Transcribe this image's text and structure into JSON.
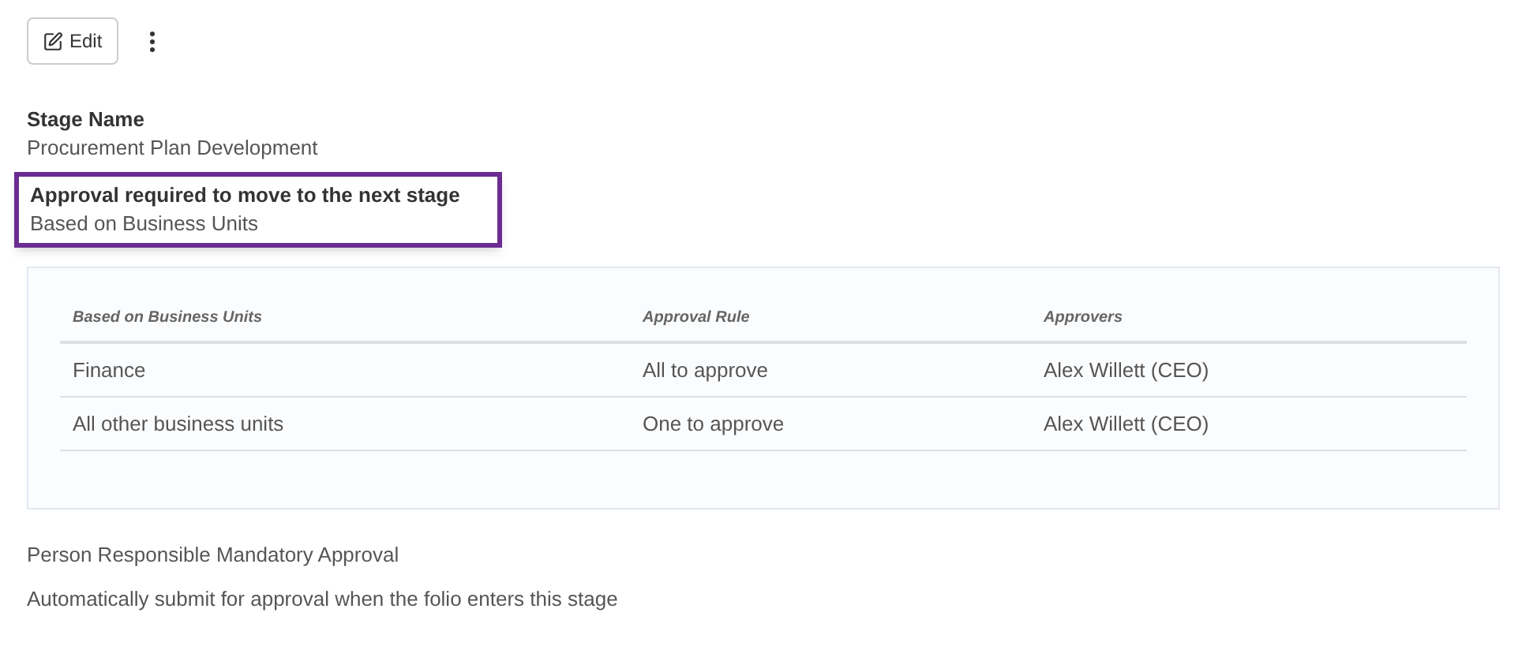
{
  "toolbar": {
    "edit_button": "Edit"
  },
  "fields": [
    {
      "label": "Stage Name",
      "value": "Procurement Plan Development",
      "highlighted": false
    },
    {
      "label": "Approval required to move to the next stage",
      "value": "Based on Business Units",
      "highlighted": true
    }
  ],
  "table": {
    "columns": [
      "Based on Business Units",
      "Approval Rule",
      "Approvers"
    ],
    "rows": [
      [
        "Finance",
        "All to approve",
        "Alex Willett (CEO)"
      ],
      [
        "All other business units",
        "One to approve",
        "Alex Willett (CEO)"
      ]
    ]
  },
  "notes": [
    "Person Responsible Mandatory Approval",
    "Automatically submit for approval when the folio enters this stage"
  ]
}
